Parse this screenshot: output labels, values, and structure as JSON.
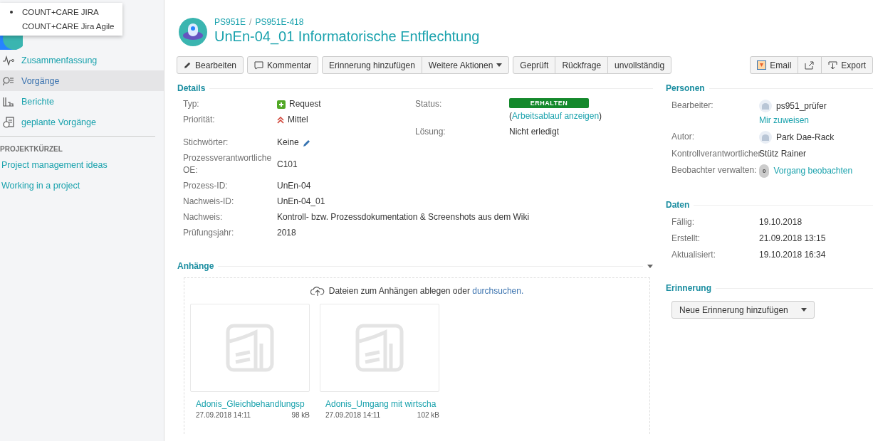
{
  "app_menu": [
    {
      "label": "COUNT+CARE JIRA",
      "selected": true
    },
    {
      "label": "COUNT+CARE Jira Agile",
      "selected": false
    }
  ],
  "sidebar": {
    "items": [
      {
        "label": "Zusammenfassung",
        "selected": false
      },
      {
        "label": "Vorgänge",
        "selected": true
      },
      {
        "label": "Berichte",
        "selected": false
      },
      {
        "label": "geplante Vorgänge",
        "selected": false
      }
    ],
    "shortcuts_heading": "PROJEKTKÜRZEL",
    "shortcuts": [
      "Project management ideas",
      "Working in a project"
    ]
  },
  "breadcrumbs": [
    "PS951E",
    "PS951E-418"
  ],
  "breadcrumb_separator": "/",
  "title": "UnEn-04_01 Informatorische Entflechtung",
  "toolbar": [
    [
      {
        "label": "Bearbeiten"
      }
    ],
    [
      {
        "label": "Kommentar"
      }
    ],
    [
      {
        "label": "Erinnerung hinzufügen"
      },
      {
        "label": "Weitere Aktionen"
      }
    ],
    [
      {
        "label": "Geprüft"
      },
      {
        "label": "Rückfrage"
      },
      {
        "label": "unvollständig"
      }
    ]
  ],
  "toolbar_right": [
    {
      "kind": "email",
      "label": "Email"
    },
    {
      "kind": "share"
    },
    {
      "kind": "export",
      "label": "Export"
    }
  ],
  "details": {
    "heading": "Details",
    "left": [
      {
        "label": "Typ:",
        "value": "Request",
        "kind": "type"
      },
      {
        "label": "Priorität:",
        "value": "Mittel",
        "kind": "priority"
      },
      {
        "label": "Stichwörter:",
        "value": "Keine",
        "kind": "editable"
      },
      {
        "label": "Prozessverantwortliche OE:",
        "value": "C101",
        "kind": "plain"
      },
      {
        "label": "Prozess-ID:",
        "value": "UnEn-04",
        "kind": "plain"
      },
      {
        "label": "Nachweis-ID:",
        "value": "UnEn-04_01",
        "kind": "plain"
      },
      {
        "label": "Nachweis:",
        "value": "Kontroll- bzw. Prozessdokumentation & Screenshots aus dem Wiki",
        "kind": "plain"
      },
      {
        "label": "Prüfungsjahr:",
        "value": "2018",
        "kind": "plain"
      }
    ],
    "status": {
      "label": "Status:",
      "value": "ERHALTEN",
      "color": "#14892c",
      "workflow_open": "(",
      "workflow_link": "Arbeitsablauf anzeigen",
      "workflow_close": ")"
    },
    "resolution": {
      "label": "Lösung:",
      "value": "Nicht erledigt"
    }
  },
  "attachments": {
    "heading": "Anhänge",
    "drop_text": "Dateien zum Anhängen ablegen oder",
    "browse_link": "durchsuchen.",
    "files": [
      {
        "name": "Adonis_Gleichbehandlungsp",
        "date": "27.09.2018 14:11",
        "size": "98 kB"
      },
      {
        "name": "Adonis_Umgang mit wirtscha",
        "date": "27.09.2018 14:11",
        "size": "102 kB"
      }
    ]
  },
  "people": {
    "heading": "Personen",
    "rows": [
      {
        "label": "Bearbeiter:",
        "value": "ps951_prüfer",
        "kind": "user",
        "link": "Mir zuweisen"
      },
      {
        "label": "Autor:",
        "value": "Park Dae-Rack",
        "kind": "user"
      },
      {
        "label": "Kontrollverantwortlicher",
        "value": "Stütz Rainer",
        "kind": "plain"
      },
      {
        "label": "Beobachter verwalten:",
        "value": "Vorgang beobachten",
        "kind": "watch",
        "count": "0"
      }
    ]
  },
  "dates": {
    "heading": "Daten",
    "rows": [
      {
        "label": "Fällig:",
        "value": "19.10.2018"
      },
      {
        "label": "Erstellt:",
        "value": "21.09.2018 13:15"
      },
      {
        "label": "Aktualisiert:",
        "value": "19.10.2018 16:34"
      }
    ]
  },
  "reminder": {
    "heading": "Erinnerung",
    "button": "Neue Erinnerung hinzufügen"
  }
}
